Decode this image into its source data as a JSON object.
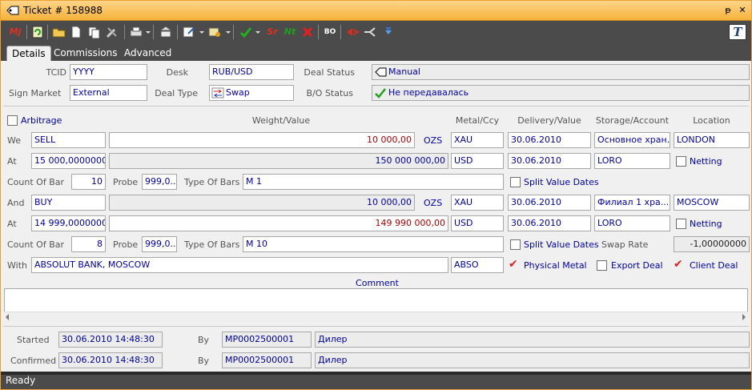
{
  "window": {
    "title": "Ticket # 158988",
    "pin": "ᵽ",
    "close": "✕"
  },
  "toolbar": {
    "mj_label": "Mj",
    "sr_label": "Sr",
    "nt_label": "Nt",
    "bo_label": "BO",
    "t_label": "T"
  },
  "tabs": [
    {
      "label": "Details"
    },
    {
      "label": "Commissions"
    },
    {
      "label": "Advanced"
    }
  ],
  "header": {
    "tcid_label": "TCID",
    "tcid_value": "YYYY",
    "desk_label": "Desk",
    "desk_value": "RUB/USD",
    "deal_status_label": "Deal Status",
    "deal_status_value": "Manual",
    "sign_market_label": "Sign Market",
    "sign_market_value": "External",
    "deal_type_label": "Deal Type",
    "deal_type_value": "Swap",
    "bo_status_label": "B/O Status",
    "bo_status_value": "Не передавалась"
  },
  "columns": {
    "arbitrage": "Arbitrage",
    "weight_value": "Weight/Value",
    "metal_ccy": "Metal/Ccy",
    "delivery_value": "Delivery/Value",
    "storage_account": "Storage/Account",
    "location": "Location"
  },
  "leg1": {
    "we_label": "We",
    "side": "SELL",
    "weight": "10 000,00",
    "unit": "OZS",
    "metal": "XAU",
    "delivery": "30.06.2010",
    "storage": "Основное хран...",
    "location": "LONDON",
    "at_label": "At",
    "price": "15 000,00000000",
    "value": "150 000 000,00",
    "ccy": "USD",
    "value_date": "30.06.2010",
    "account": "LORO",
    "netting_label": "Netting",
    "count_label": "Count Of Bar",
    "count": "10",
    "probe_label": "Probe",
    "probe": "999,0...",
    "type_label": "Type Of Bars",
    "type": "M 1",
    "split_label": "Split Value Dates"
  },
  "leg2": {
    "and_label": "And",
    "side": "BUY",
    "weight": "10 000,00",
    "unit": "OZS",
    "metal": "XAU",
    "delivery": "30.06.2010",
    "storage": "Филиал  1 хра...",
    "location": "MOSCOW",
    "at_label": "At",
    "price": "14 999,00000000",
    "value": "149 990 000,00",
    "ccy": "USD",
    "value_date": "30.06.2010",
    "account": "LORO",
    "netting_label": "Netting",
    "count_label": "Count Of Bar",
    "count": "8",
    "probe_label": "Probe",
    "probe": "999,0...",
    "type_label": "Type Of Bars",
    "type": "M 10",
    "split_label": "Split Value Dates",
    "swap_rate_label": "Swap Rate",
    "swap_rate": "-1,00000000"
  },
  "counterparty": {
    "with_label": "With",
    "name": "ABSOLUT BANK, MOSCOW",
    "code": "ABSO",
    "physical_metal": "Physical Metal",
    "export_deal": "Export Deal",
    "client_deal": "Client Deal"
  },
  "comment": {
    "label": "Comment",
    "value": ""
  },
  "audit": {
    "started_label": "Started",
    "started_time": "30.06.2010 14:48:30",
    "started_by_label": "By",
    "started_by": "MP0002500001",
    "started_role": "Дилер",
    "confirmed_label": "Confirmed",
    "confirmed_time": "30.06.2010 14:48:30",
    "confirmed_by_label": "By",
    "confirmed_by": "MP0002500001",
    "confirmed_role": "Дилер"
  },
  "status": {
    "text": "Ready"
  },
  "colors": {
    "accent": "#f4b23a",
    "toolbar": "#4b4b4b",
    "value_text": "#0000a8",
    "red_value": "#b00000"
  }
}
